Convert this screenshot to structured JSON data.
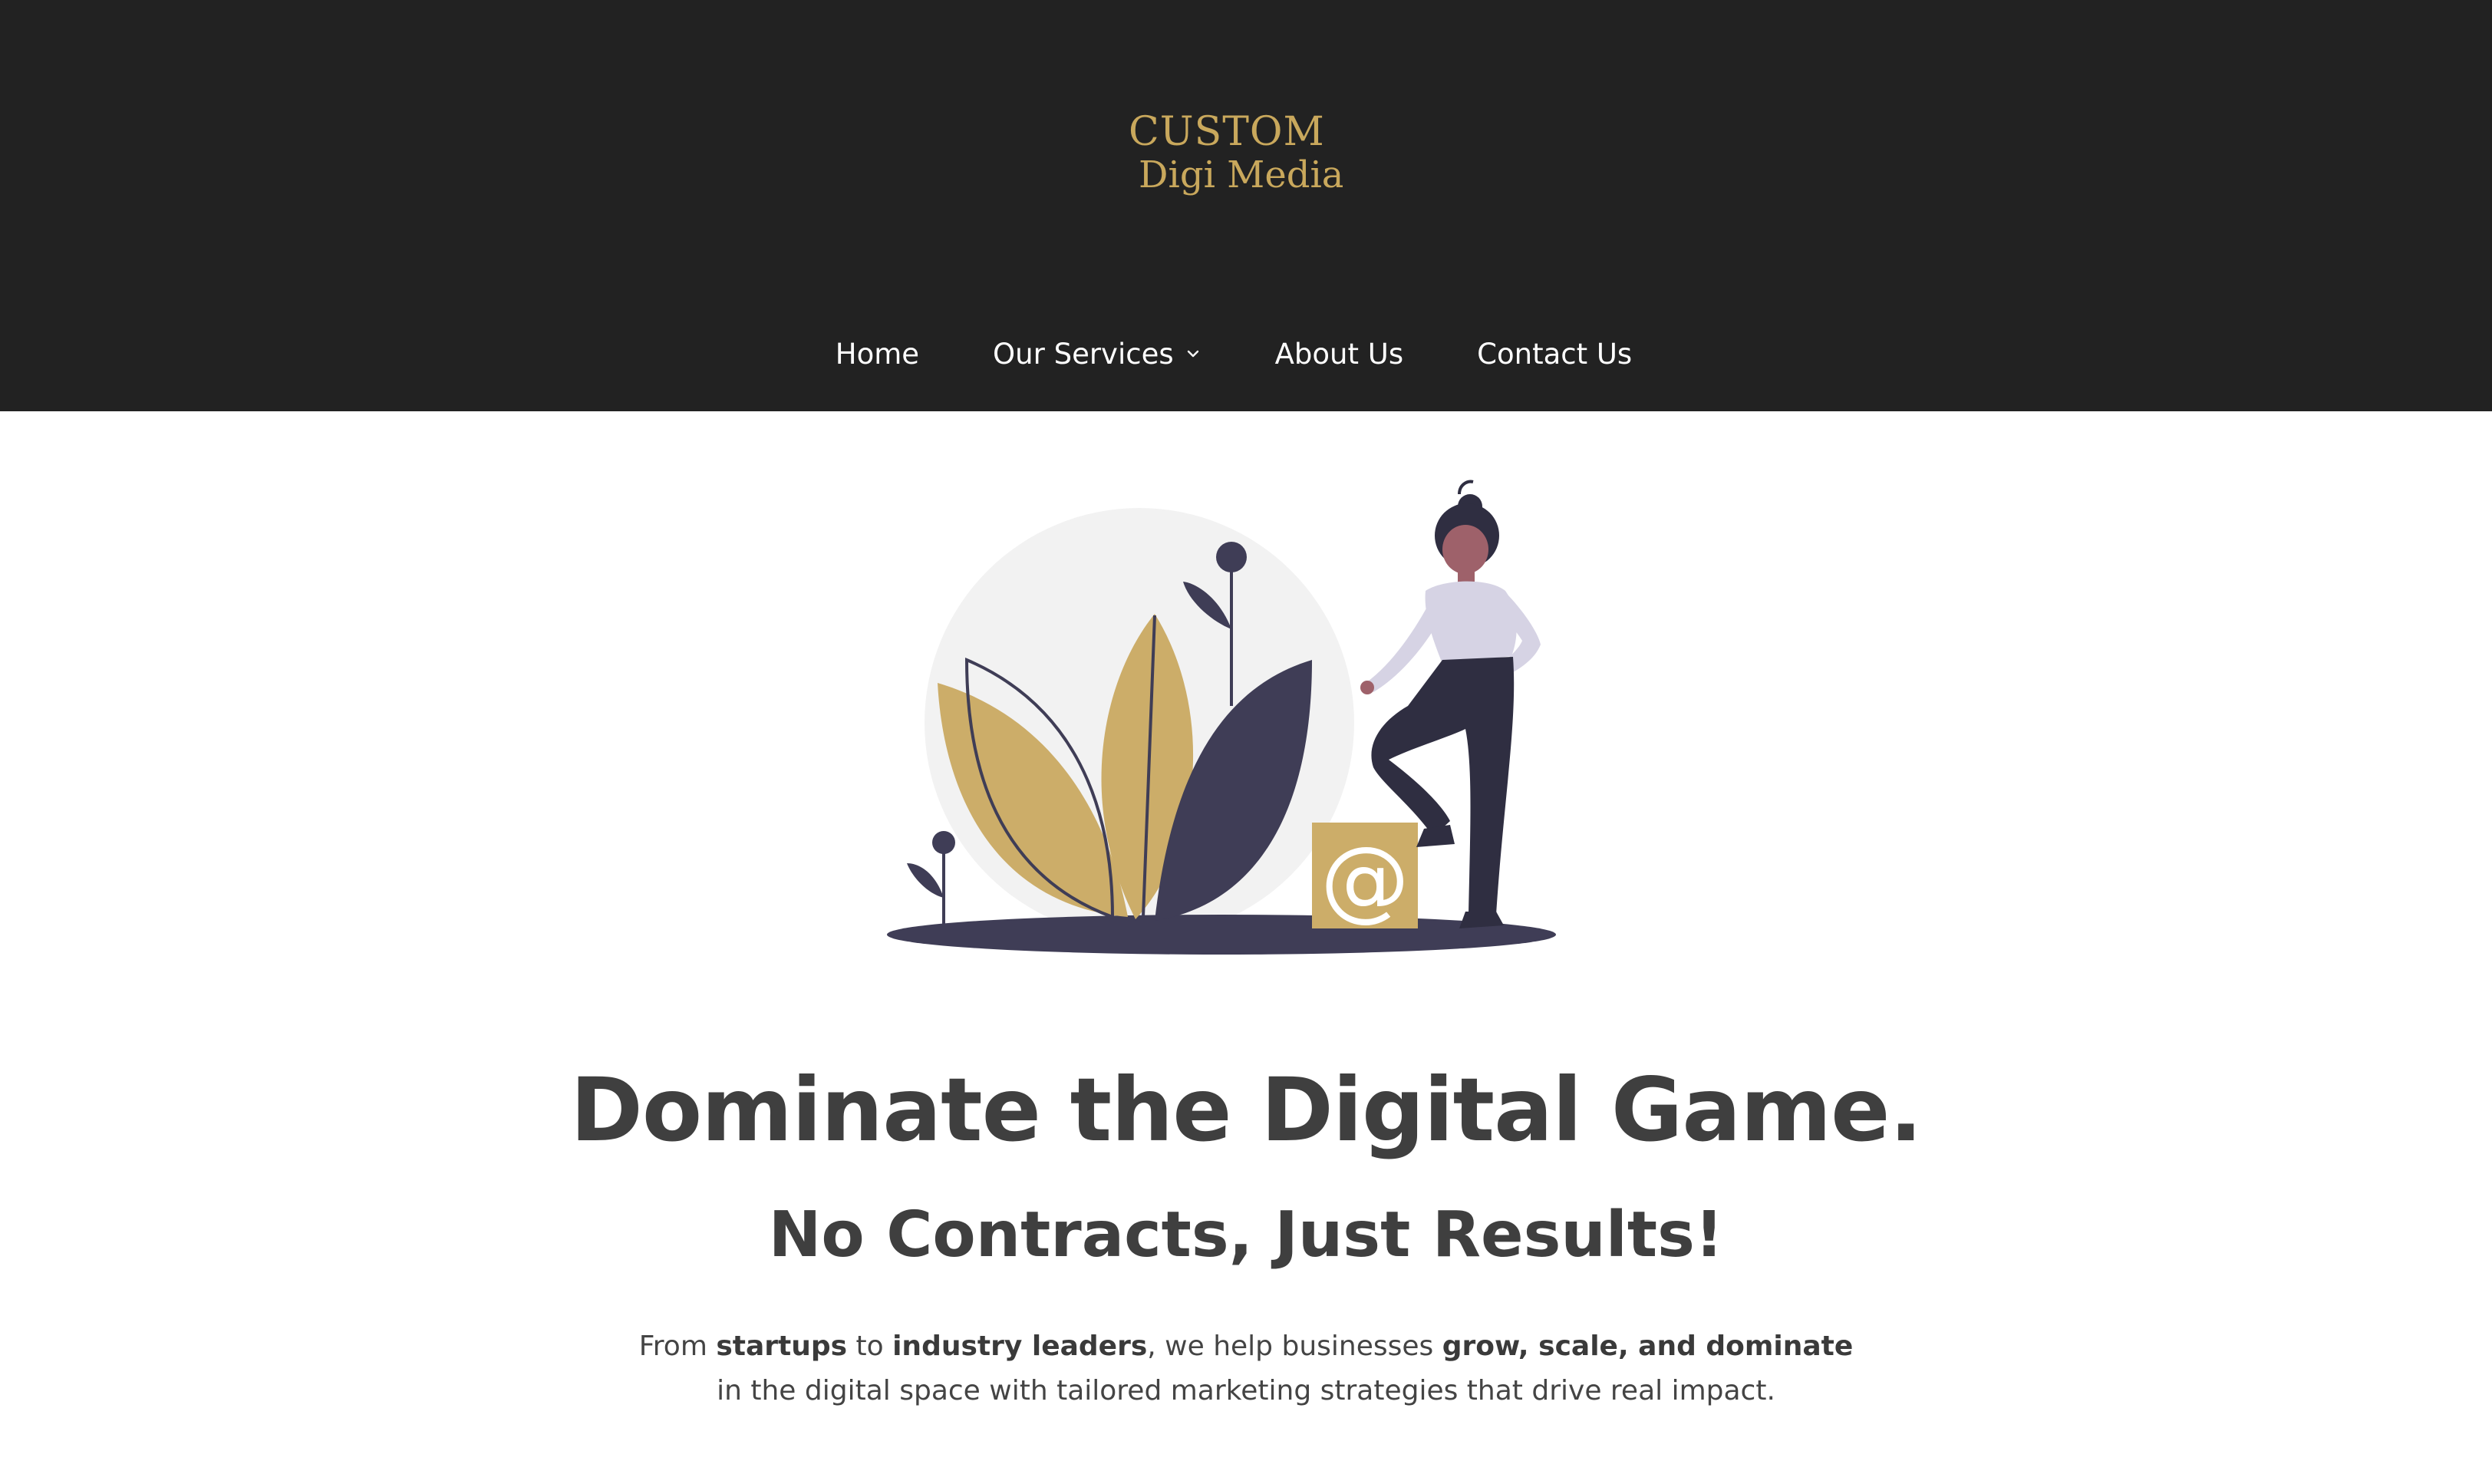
{
  "brand": {
    "line1": "CUSTOM",
    "line2": "Digi Media",
    "color": "#c9a85c"
  },
  "nav": {
    "items": [
      {
        "label": "Home"
      },
      {
        "label": "Our Services",
        "has_dropdown": true
      },
      {
        "label": "About Us"
      },
      {
        "label": "Contact Us"
      }
    ]
  },
  "hero": {
    "illustration_icon": "woman-with-plant-and-at-sign-illustration",
    "headline": "Dominate the Digital Game.",
    "subheadline": "No Contracts, Just Results!",
    "intro": {
      "p1": "From ",
      "b1": "startups",
      "p2": " to ",
      "b2": "industry leaders",
      "p3": ", we help businesses ",
      "b3": "grow, scale, and dominate",
      "p4": " in the digital space with tailored marketing strategies that drive real impact."
    }
  },
  "colors": {
    "header_bg": "#222222",
    "accent": "#c9a85c",
    "dark_purple": "#3f3d56",
    "text": "#3f3f3f"
  }
}
